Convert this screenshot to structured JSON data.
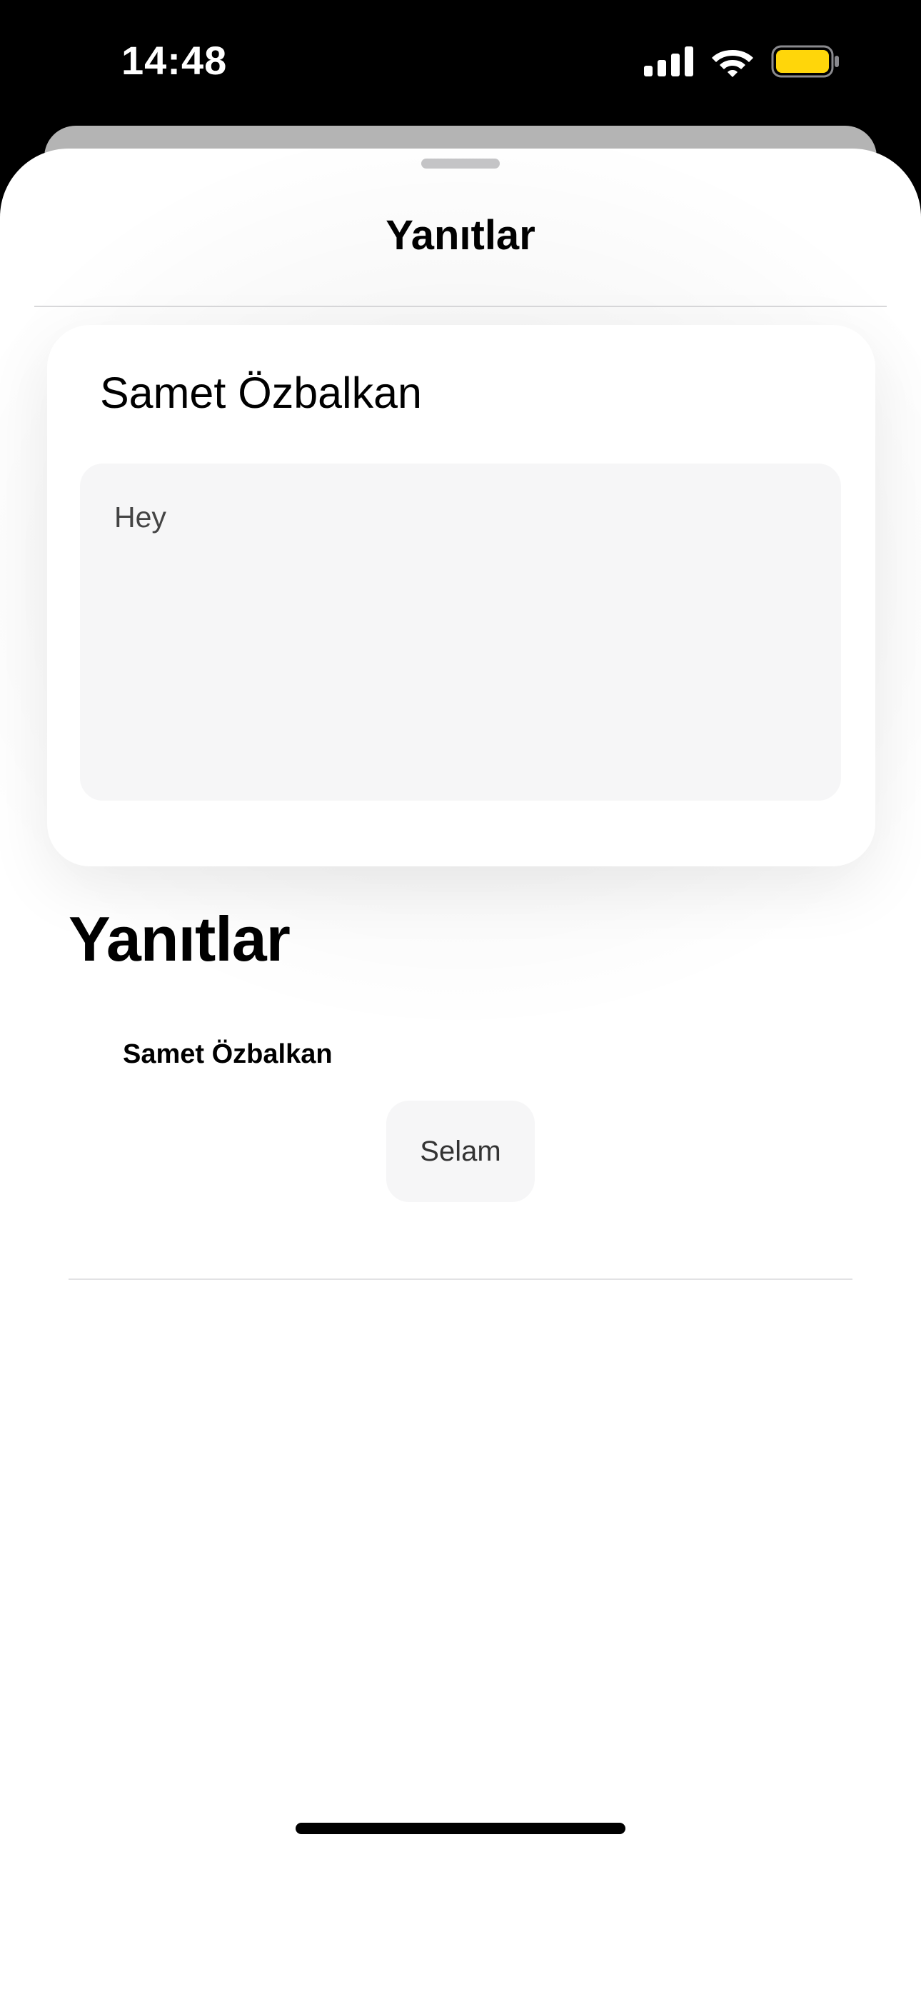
{
  "status_bar": {
    "time": "14:48"
  },
  "sheet": {
    "title": "Yanıtlar"
  },
  "compose": {
    "author": "Samet Özbalkan",
    "text": "Hey"
  },
  "replies": {
    "heading": "Yanıtlar",
    "items": [
      {
        "author": "Samet Özbalkan",
        "text": "Selam"
      }
    ]
  },
  "colors": {
    "battery": "#FFD60A",
    "background": "#000000",
    "sheet": "#FFFFFF",
    "input_fill": "#F6F6F7"
  },
  "icons": [
    "cellular-signal-icon",
    "wifi-icon",
    "battery-icon"
  ]
}
